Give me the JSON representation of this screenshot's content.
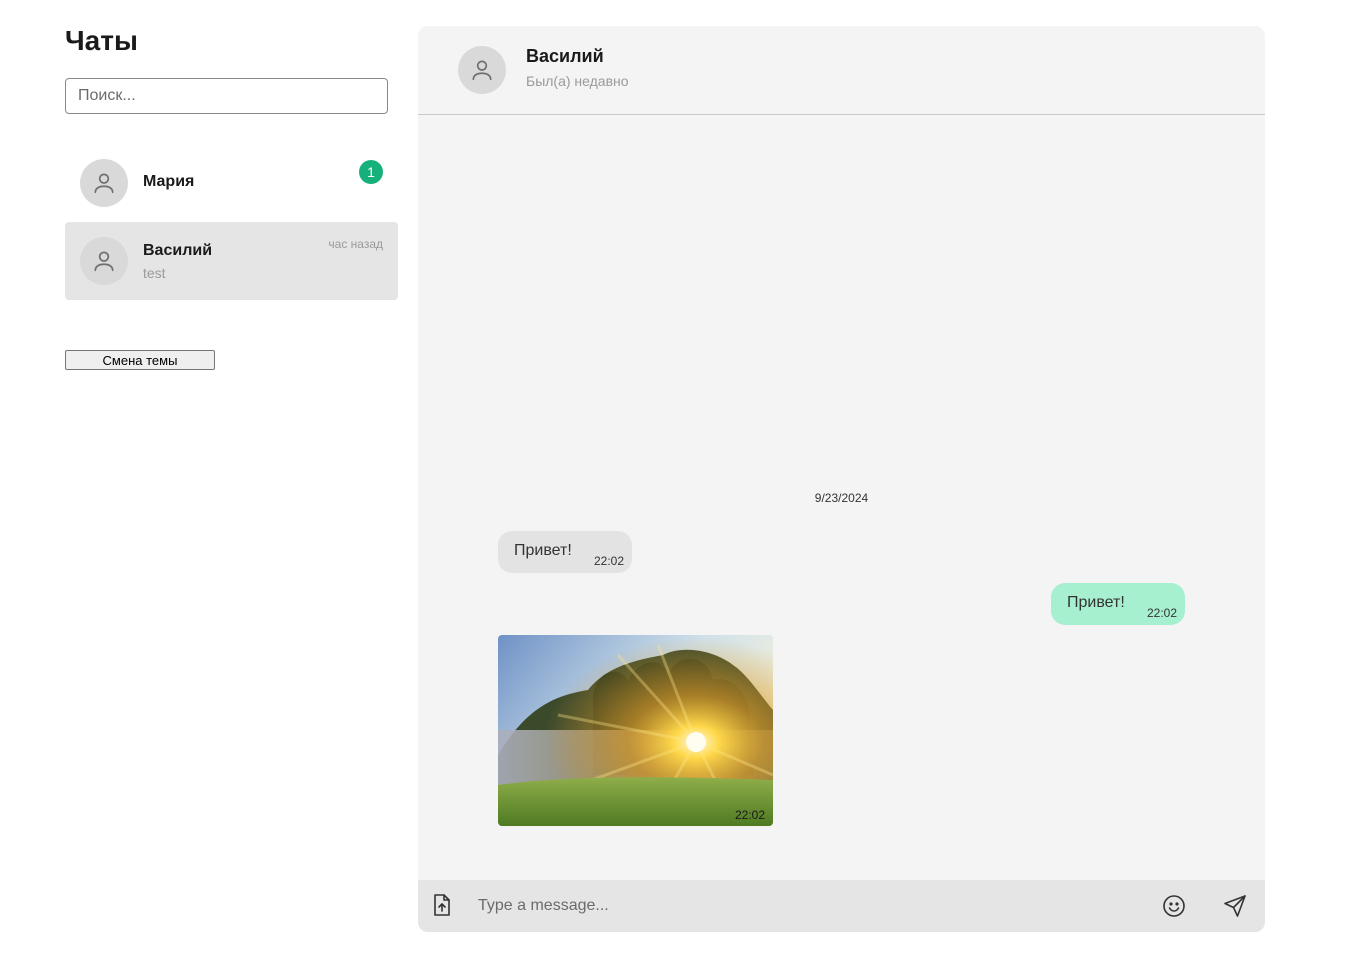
{
  "sidebar": {
    "title": "Чаты",
    "search_placeholder": "Поиск...",
    "chats": [
      {
        "name": "Мария",
        "unread": "1",
        "avatar_icon": "user-icon"
      },
      {
        "name": "Василий",
        "time": "час назад",
        "preview": "test",
        "avatar_icon": "user-icon",
        "active": true
      }
    ],
    "theme_button": "Смена темы"
  },
  "chat": {
    "contact_name": "Василий",
    "contact_status": "Был(а) недавно",
    "date_separator": "9/23/2024",
    "messages": [
      {
        "direction": "incoming",
        "text": "Привет!",
        "time": "22:02"
      },
      {
        "direction": "outgoing",
        "text": "Привет!",
        "time": "22:02"
      },
      {
        "direction": "incoming",
        "type": "image",
        "image_subject": "sunlight through trees in foggy meadow",
        "time": "22:02"
      }
    ],
    "composer_placeholder": "Type a message..."
  },
  "icons": [
    "user-icon",
    "attach-file-icon",
    "emoji-icon",
    "send-icon"
  ],
  "colors": {
    "panel_bg": "#f4f4f4",
    "incoming_bubble": "#e3e3e3",
    "outgoing_bubble": "#a7f0cf",
    "unread_badge": "#16b07a",
    "active_chat_bg": "#e5e5e5"
  }
}
